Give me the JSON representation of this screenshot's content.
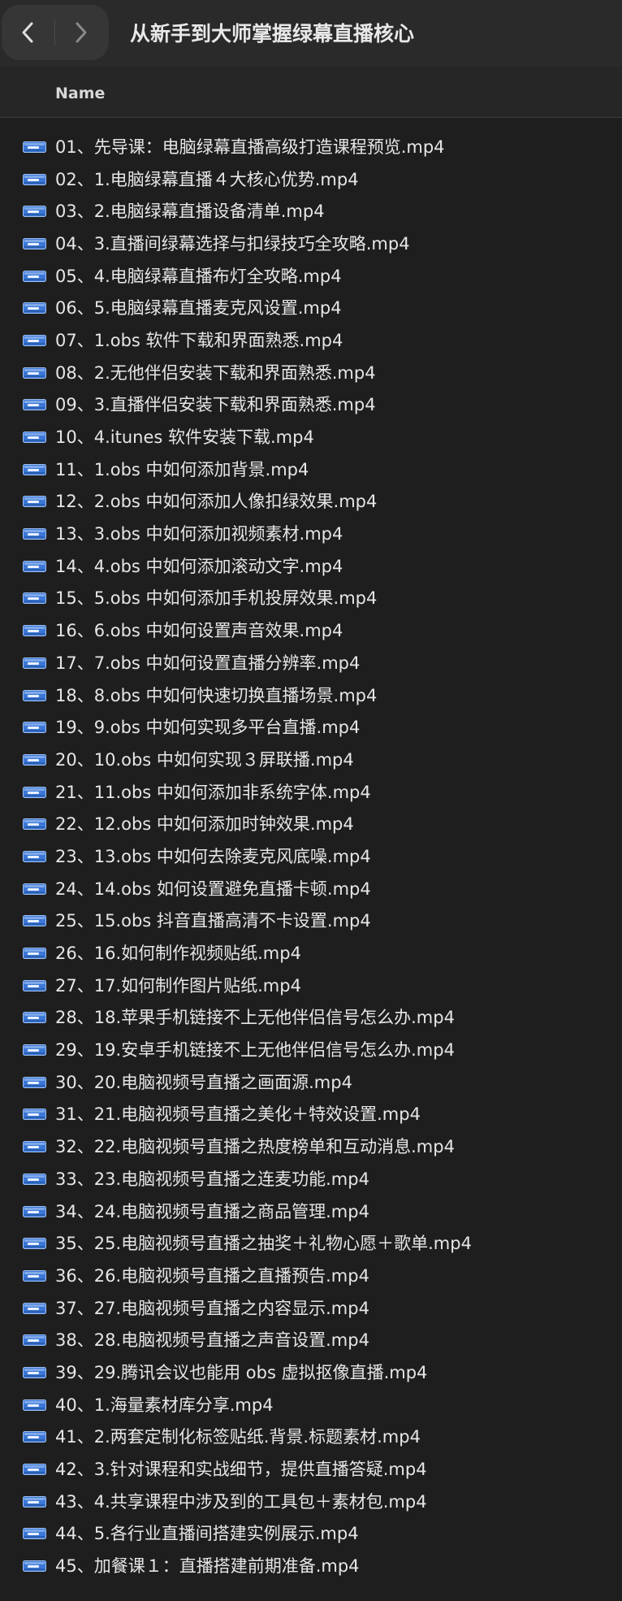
{
  "window": {
    "title": "从新手到大师掌握绿幕直播核心"
  },
  "header": {
    "name_column": "Name"
  },
  "files": [
    "01、先导课：电脑绿幕直播高级打造课程预览.mp4",
    "02、1.电脑绿幕直播４大核心优势.mp4",
    "03、2.电脑绿幕直播设备清单.mp4",
    "04、3.直播间绿幕选择与扣绿技巧全攻略.mp4",
    "05、4.电脑绿幕直播布灯全攻略.mp4",
    "06、5.电脑绿幕直播麦克风设置.mp4",
    "07、1.obs 软件下载和界面熟悉.mp4",
    "08、2.无他伴侣安装下载和界面熟悉.mp4",
    "09、3.直播伴侣安装下载和界面熟悉.mp4",
    "10、4.itunes 软件安装下载.mp4",
    "11、1.obs 中如何添加背景.mp4",
    "12、2.obs 中如何添加人像扣绿效果.mp4",
    "13、3.obs 中如何添加视频素材.mp4",
    "14、4.obs 中如何添加滚动文字.mp4",
    "15、5.obs 中如何添加手机投屏效果.mp4",
    "16、6.obs 中如何设置声音效果.mp4",
    "17、7.obs 中如何设置直播分辨率.mp4",
    "18、8.obs 中如何快速切换直播场景.mp4",
    "19、9.obs 中如何实现多平台直播.mp4",
    "20、10.obs 中如何实现３屏联播.mp4",
    "21、11.obs 中如何添加非系统字体.mp4",
    "22、12.obs 中如何添加时钟效果.mp4",
    "23、13.obs 中如何去除麦克风底噪.mp4",
    "24、14.obs 如何设置避免直播卡顿.mp4",
    "25、15.obs 抖音直播高清不卡设置.mp4",
    "26、16.如何制作视频贴纸.mp4",
    "27、17.如何制作图片贴纸.mp4",
    "28、18.苹果手机链接不上无他伴侣信号怎么办.mp4",
    "29、19.安卓手机链接不上无他伴侣信号怎么办.mp4",
    "30、20.电脑视频号直播之画面源.mp4",
    "31、21.电脑视频号直播之美化＋特效设置.mp4",
    "32、22.电脑视频号直播之热度榜单和互动消息.mp4",
    "33、23.电脑视频号直播之连麦功能.mp4",
    "34、24.电脑视频号直播之商品管理.mp4",
    "35、25.电脑视频号直播之抽奖＋礼物心愿＋歌单.mp4",
    "36、26.电脑视频号直播之直播预告.mp4",
    "37、27.电脑视频号直播之内容显示.mp4",
    "38、28.电脑视频号直播之声音设置.mp4",
    "39、29.腾讯会议也能用 obs 虚拟抠像直播.mp4",
    "40、1.海量素材库分享.mp4",
    "41、2.两套定制化标签贴纸.背景.标题素材.mp4",
    "42、3.针对课程和实战细节，提供直播答疑.mp4",
    "43、4.共享课程中涉及到的工具包＋素材包.mp4",
    "44、5.各行业直播间搭建实例展示.mp4",
    "45、加餐课１：直播搭建前期准备.mp4"
  ],
  "icons": {
    "back": "chevron-left-icon",
    "forward": "chevron-right-icon",
    "file": "video-file-icon"
  },
  "colors": {
    "background": "#1e1e1e",
    "titlebar": "#2a2a2a",
    "text": "#e6e6e6",
    "icon_blue": "#3b78d8"
  }
}
